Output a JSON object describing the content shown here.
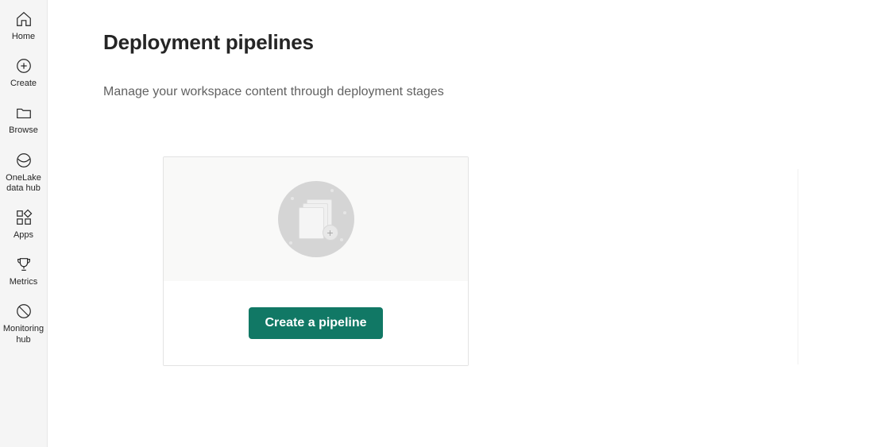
{
  "sidebar": {
    "items": [
      {
        "label": "Home"
      },
      {
        "label": "Create"
      },
      {
        "label": "Browse"
      },
      {
        "label": "OneLake\ndata hub"
      },
      {
        "label": "Apps"
      },
      {
        "label": "Metrics"
      },
      {
        "label": "Monitoring\nhub"
      }
    ]
  },
  "page": {
    "title": "Deployment pipelines",
    "subtitle": "Manage your workspace content through deployment stages"
  },
  "card": {
    "create_label": "Create a pipeline"
  }
}
